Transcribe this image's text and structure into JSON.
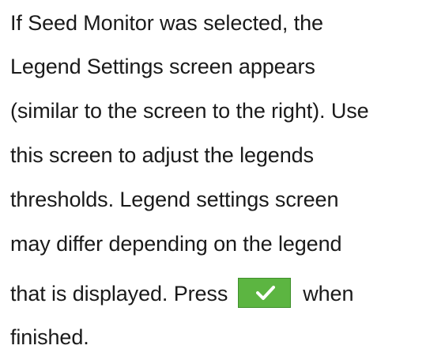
{
  "paragraph": {
    "lines": [
      "If Seed Monitor was selected, the",
      "Legend Settings screen appears",
      "(similar to the screen to the right). Use",
      "this screen to adjust the legends",
      "thresholds. Legend settings screen",
      "may differ depending on the legend"
    ],
    "line7_before": "that is displayed. Press",
    "line7_after": "when",
    "line8": "finished."
  },
  "confirm_button": {
    "icon": "checkmark-icon",
    "color": "#5cb541"
  }
}
